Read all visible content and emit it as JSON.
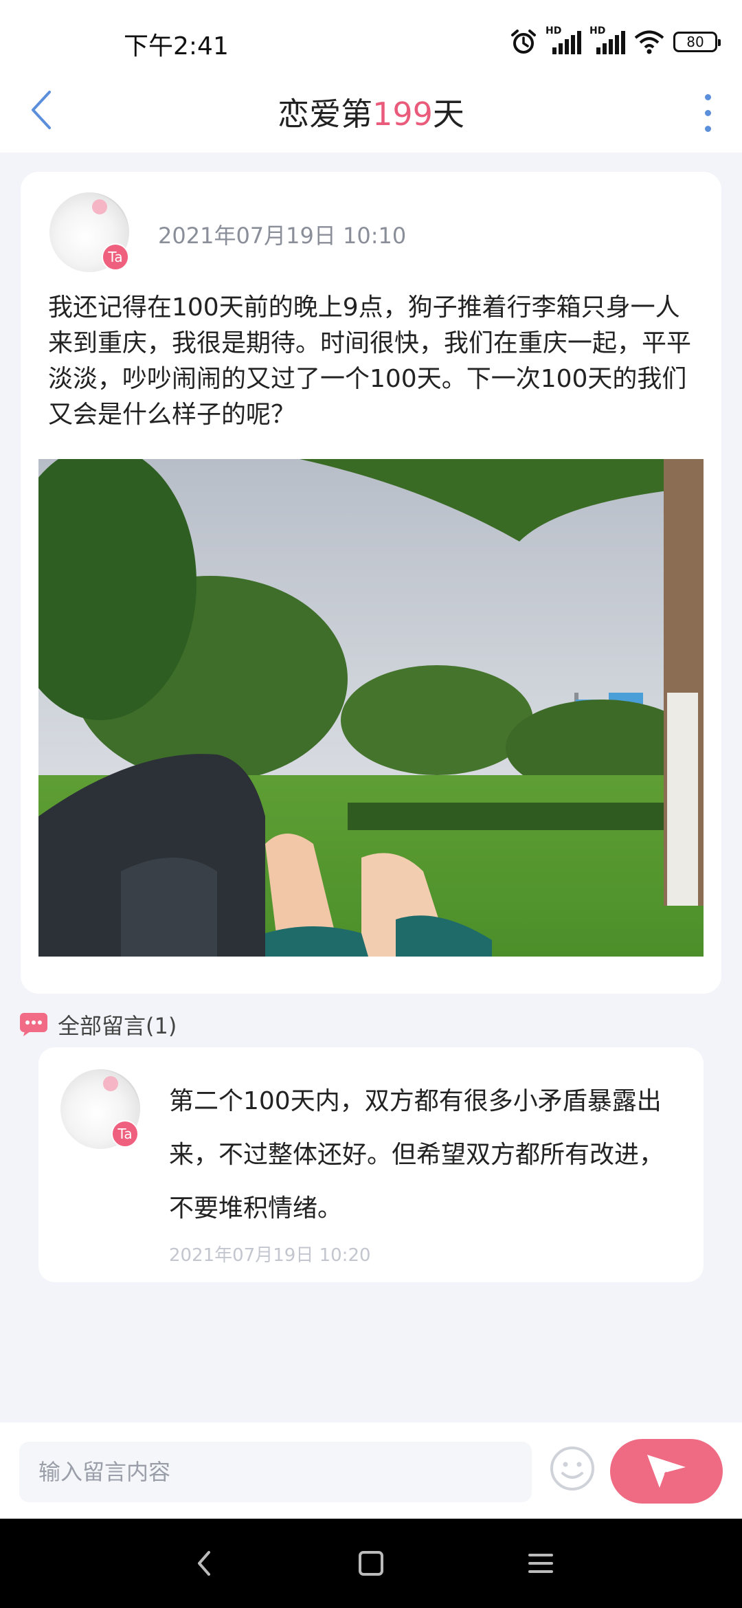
{
  "status_bar": {
    "time": "下午2:41",
    "battery": "80",
    "icons": [
      "alarm-icon",
      "hd-signal-icon",
      "hd-signal-icon",
      "wifi-icon",
      "battery-icon"
    ]
  },
  "header": {
    "title_prefix": "恋爱第",
    "title_number": "199",
    "title_suffix": "天",
    "accent_color": "#ea5a7a"
  },
  "post": {
    "avatar_badge": "Ta",
    "date": "2021年07月19日  10:10",
    "text": "我还记得在100天前的晚上9点，狗子推着行李箱只身一人来到重庆，我很是期待。时间很快，我们在重庆一起，平平淡淡，吵吵闹闹的又过了一个100天。下一次100天的我们又会是什么样子的呢？"
  },
  "comments": {
    "label": "全部留言(1)",
    "items": [
      {
        "avatar_badge": "Ta",
        "text": "第二个100天内，双方都有很多小矛盾暴露出来，不过整体还好。但希望双方都所有改进，不要堆积情绪。",
        "date": "2021年07月19日 10:20"
      }
    ]
  },
  "input_bar": {
    "placeholder": "输入留言内容",
    "send_color": "#ef6a83"
  },
  "nav_bar": {
    "icons": [
      "back-triangle-icon",
      "home-square-icon",
      "menu-lines-icon"
    ]
  }
}
